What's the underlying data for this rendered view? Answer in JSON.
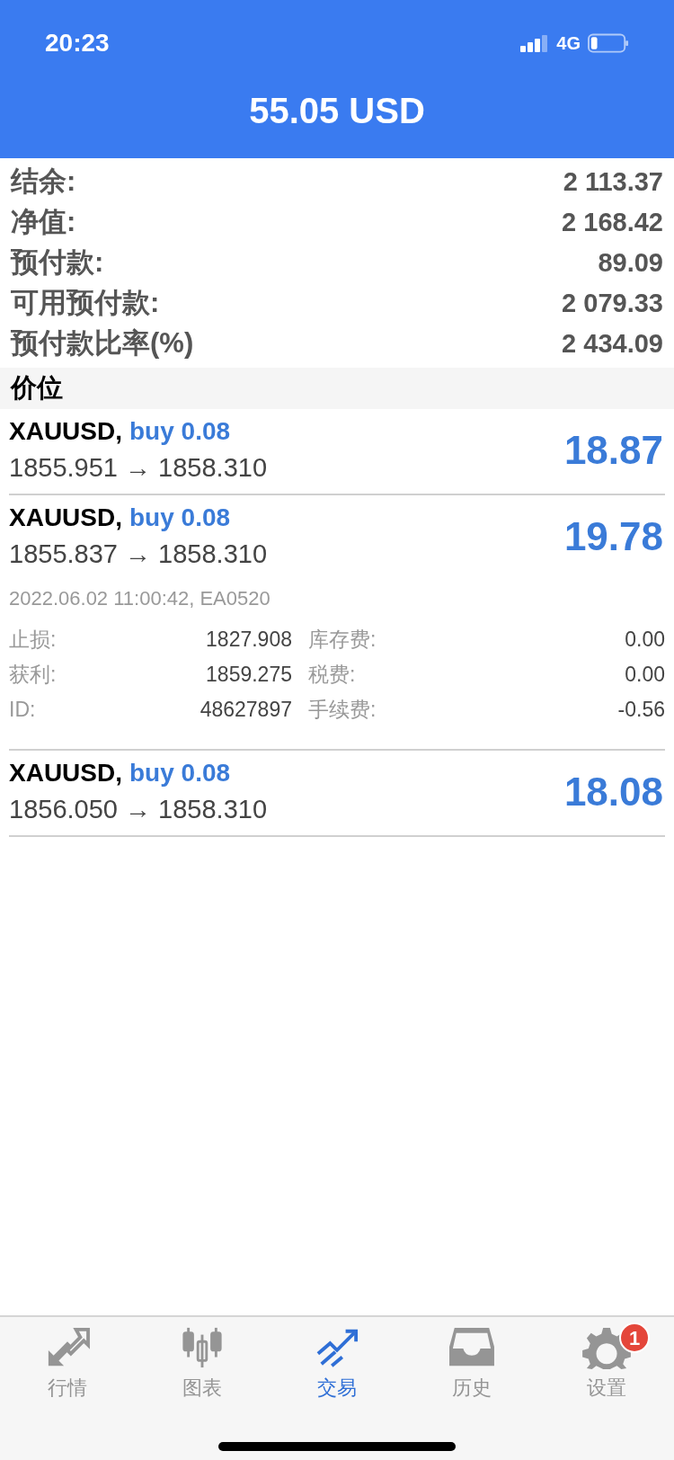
{
  "status_bar": {
    "time": "20:23",
    "network": "4G"
  },
  "header": {
    "title": "55.05 USD"
  },
  "summary": [
    {
      "label": "结余:",
      "value": "2 113.37"
    },
    {
      "label": "净值:",
      "value": "2 168.42"
    },
    {
      "label": "预付款:",
      "value": "89.09"
    },
    {
      "label": "可用预付款:",
      "value": "2 079.33"
    },
    {
      "label": "预付款比率(%)",
      "value": "2 434.09"
    }
  ],
  "section": {
    "title": "价位"
  },
  "positions": [
    {
      "symbol": "XAUUSD,",
      "side": "buy 0.08",
      "prices": "1855.951 → 1858.310",
      "profit": "18.87",
      "expanded": false
    },
    {
      "symbol": "XAUUSD,",
      "side": "buy 0.08",
      "prices": "1855.837 → 1858.310",
      "profit": "19.78",
      "expanded": true,
      "meta": "2022.06.02 11:00:42, EA0520",
      "details": [
        {
          "label": "止损:",
          "value": "1827.908",
          "label2": "库存费:",
          "value2": "0.00"
        },
        {
          "label": "获利:",
          "value": "1859.275",
          "label2": "税费:",
          "value2": "0.00"
        },
        {
          "label": "ID:",
          "value": "48627897",
          "label2": "手续费:",
          "value2": "-0.56"
        }
      ]
    },
    {
      "symbol": "XAUUSD,",
      "side": "buy 0.08",
      "prices": "1856.050 → 1858.310",
      "profit": "18.08",
      "expanded": false
    }
  ],
  "tab_bar": [
    {
      "kind": "quotes",
      "label": "行情",
      "selected": false
    },
    {
      "kind": "chart",
      "label": "图表",
      "selected": false
    },
    {
      "kind": "trade",
      "label": "交易",
      "selected": true
    },
    {
      "kind": "history",
      "label": "历史",
      "selected": false
    },
    {
      "kind": "settings",
      "label": "设置",
      "selected": false,
      "badge": "1"
    }
  ]
}
